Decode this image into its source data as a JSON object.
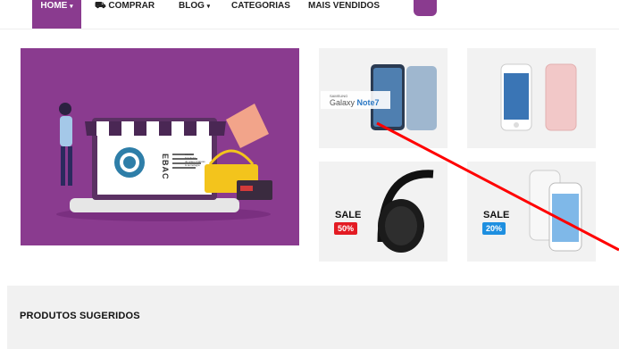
{
  "nav": {
    "home": "HOME",
    "buy": "COMPRAR",
    "blog": "BLOG",
    "categories": "CATEGORIAS",
    "best_sellers": "MAIS VENDIDOS"
  },
  "tiles": {
    "note7": {
      "brand": "SAMSUNG",
      "name_part1": "Galaxy ",
      "name_part2": "Note7"
    },
    "sale1": {
      "sale": "SALE",
      "badge": "50%",
      "badge_color": "#e31b23"
    },
    "sale2": {
      "sale": "SALE",
      "badge": "20%",
      "badge_color": "#1e8fe0"
    }
  },
  "hero": {
    "brand_lines": [
      "escola",
      "brasileira",
      "de artes criativas",
      "& tecnologia"
    ],
    "logo_letters": "EBAC"
  },
  "section": {
    "suggested_title": "PRODUTOS SUGERIDOS"
  },
  "colors": {
    "brand_purple": "#8a3b8f",
    "annotation_red": "#ff0000"
  }
}
